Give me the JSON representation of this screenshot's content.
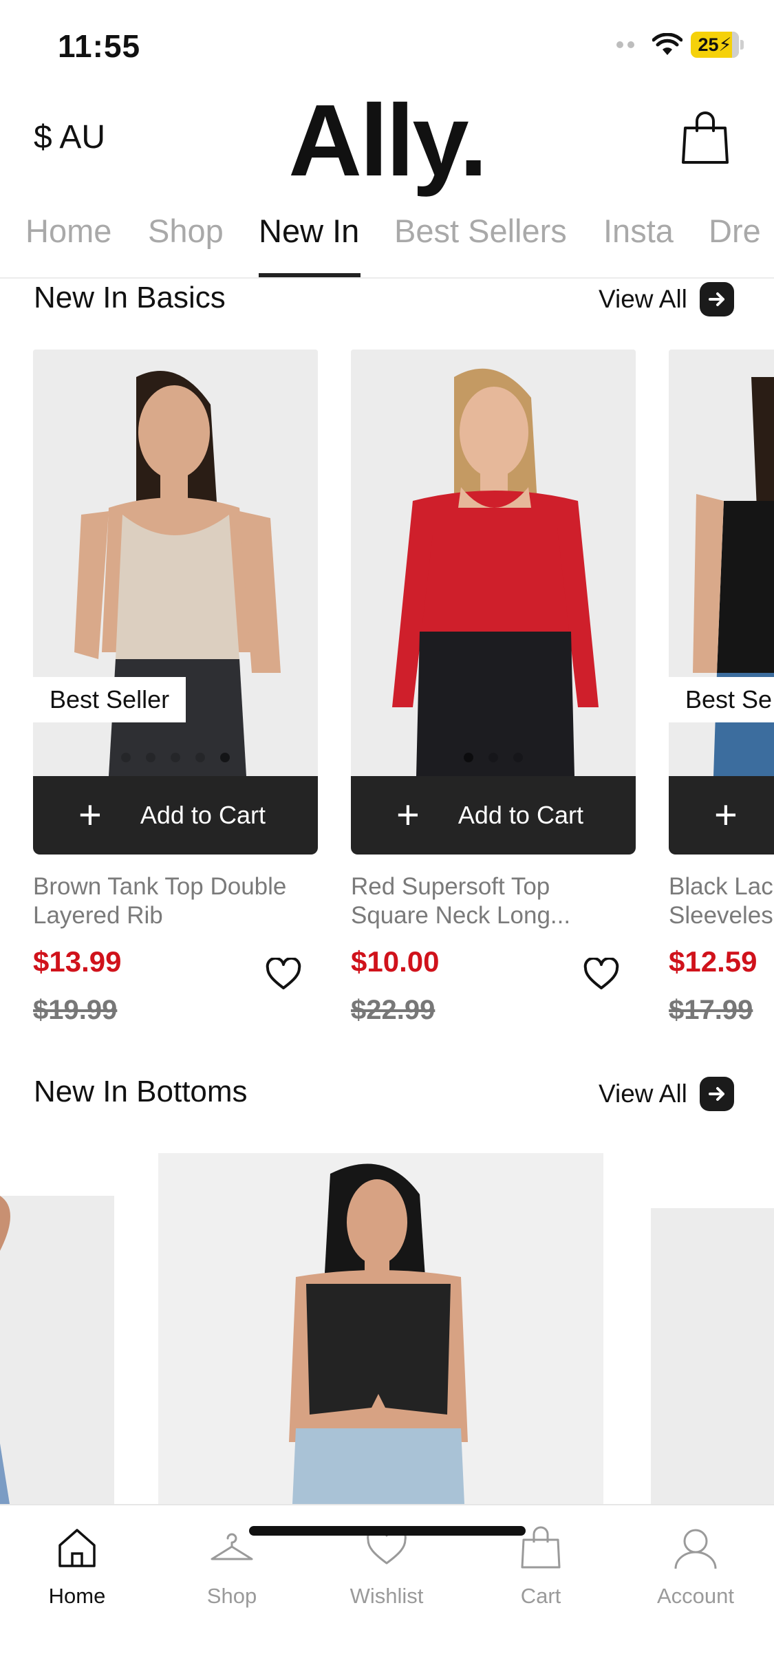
{
  "status_bar": {
    "time": "11:55",
    "battery": "25"
  },
  "header": {
    "currency": "$ AU",
    "logo": "Ally."
  },
  "tabs": [
    {
      "label": "Home"
    },
    {
      "label": "Shop"
    },
    {
      "label": "New In"
    },
    {
      "label": "Best Sellers"
    },
    {
      "label": "Insta"
    },
    {
      "label": "Dre"
    }
  ],
  "basics": {
    "title": "New In Basics",
    "view_all": "View All",
    "products": [
      {
        "badge": "Best Seller",
        "add_label": "Add to Cart",
        "name_line1": "Brown Tank Top Double",
        "name_line2": "Layered Rib",
        "price": "$13.99",
        "old_price": "$19.99",
        "colors": {
          "top": "#dccfc0",
          "bottom": "#2e2f33",
          "hair": "#2a1d15"
        }
      },
      {
        "badge": "",
        "add_label": "Add to Cart",
        "name_line1": "Red Supersoft Top",
        "name_line2": "Square Neck Long...",
        "price": "$10.00",
        "old_price": "$22.99",
        "colors": {
          "top": "#cf1f2b",
          "bottom": "#1c1c20",
          "hair": "#c49a63"
        }
      },
      {
        "badge": "Best Se",
        "add_label": "",
        "name_line1": "Black Lac",
        "name_line2": "Sleeveles",
        "price": "$12.59",
        "old_price": "$17.99",
        "colors": {
          "top": "#151515",
          "bottom": "#3c6d9e",
          "hair": "#2a1d15"
        }
      }
    ]
  },
  "bottoms": {
    "title": "New In Bottoms",
    "view_all": "View All"
  },
  "bottom_nav": [
    {
      "label": "Home",
      "icon": "home-icon",
      "active": true
    },
    {
      "label": "Shop",
      "icon": "hanger-icon",
      "active": false
    },
    {
      "label": "Wishlist",
      "icon": "heart-icon",
      "active": false
    },
    {
      "label": "Cart",
      "icon": "bag-icon",
      "active": false
    },
    {
      "label": "Account",
      "icon": "user-icon",
      "active": false
    }
  ],
  "colors": {
    "sale_red": "#d0121b",
    "button_dark": "#242424",
    "muted_text": "#9a9a9a"
  }
}
